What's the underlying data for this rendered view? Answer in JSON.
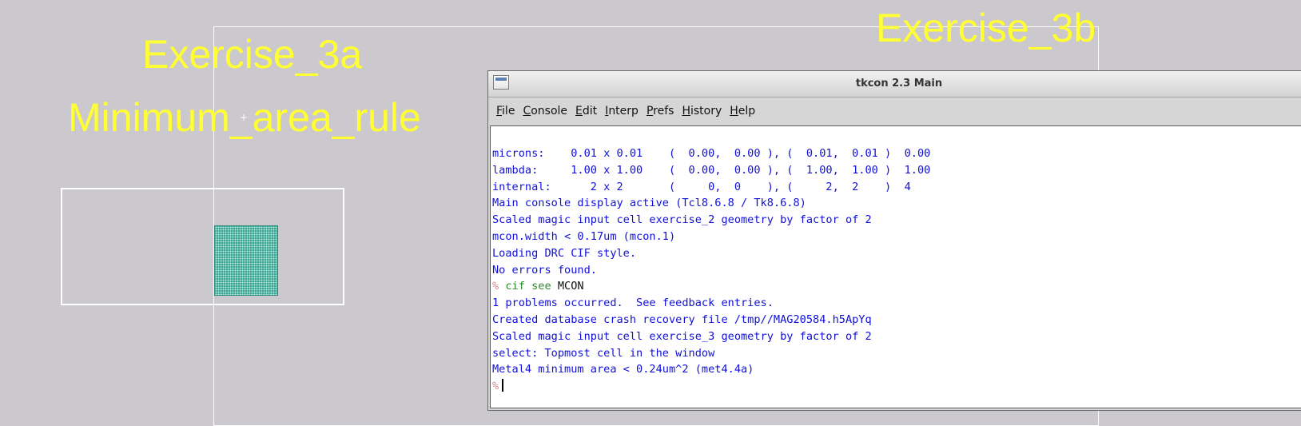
{
  "canvas": {
    "labels": {
      "exercise_3a": "Exercise_3a",
      "minimum_area_rule": "Minimum_area_rule",
      "exercise_3b": "Exercise_3b"
    },
    "label_color": "#ffff33",
    "background_color": "#cbc9cd",
    "mcon_color": "#2f9c8c"
  },
  "tkcon": {
    "title": "tkcon 2.3 Main",
    "menu": [
      {
        "pre": "",
        "ul": "F",
        "post": "ile"
      },
      {
        "pre": "",
        "ul": "C",
        "post": "onsole"
      },
      {
        "pre": "",
        "ul": "E",
        "post": "dit"
      },
      {
        "pre": "",
        "ul": "I",
        "post": "nterp"
      },
      {
        "pre": "",
        "ul": "P",
        "post": "refs"
      },
      {
        "pre": "",
        "ul": "H",
        "post": "istory"
      },
      {
        "pre": "",
        "ul": "H",
        "post": "elp"
      }
    ],
    "lines": [
      "microns:    0.01 x 0.01    (  0.00,  0.00 ), (  0.01,  0.01 )  0.00",
      "lambda:     1.00 x 1.00    (  0.00,  0.00 ), (  1.00,  1.00 )  1.00",
      "internal:      2 x 2       (     0,  0    ), (     2,  2    )  4",
      "Main console display active (Tcl8.6.8 / Tk8.6.8)",
      "Scaled magic input cell exercise_2 geometry by factor of 2",
      "mcon.width < 0.17um (mcon.1)",
      "Loading DRC CIF style.",
      "No errors found."
    ],
    "command": {
      "prompt": "%",
      "cmd": "cif see",
      "arg": "MCON"
    },
    "lines_after": [
      "1 problems occurred.  See feedback entries.",
      "Created database crash recovery file /tmp//MAG20584.h5ApYq",
      "Scaled magic input cell exercise_3 geometry by factor of 2",
      "select: Topmost cell in the window",
      "Metal4 minimum area < 0.24um^2 (met4.4a)"
    ],
    "final_prompt": "%"
  }
}
